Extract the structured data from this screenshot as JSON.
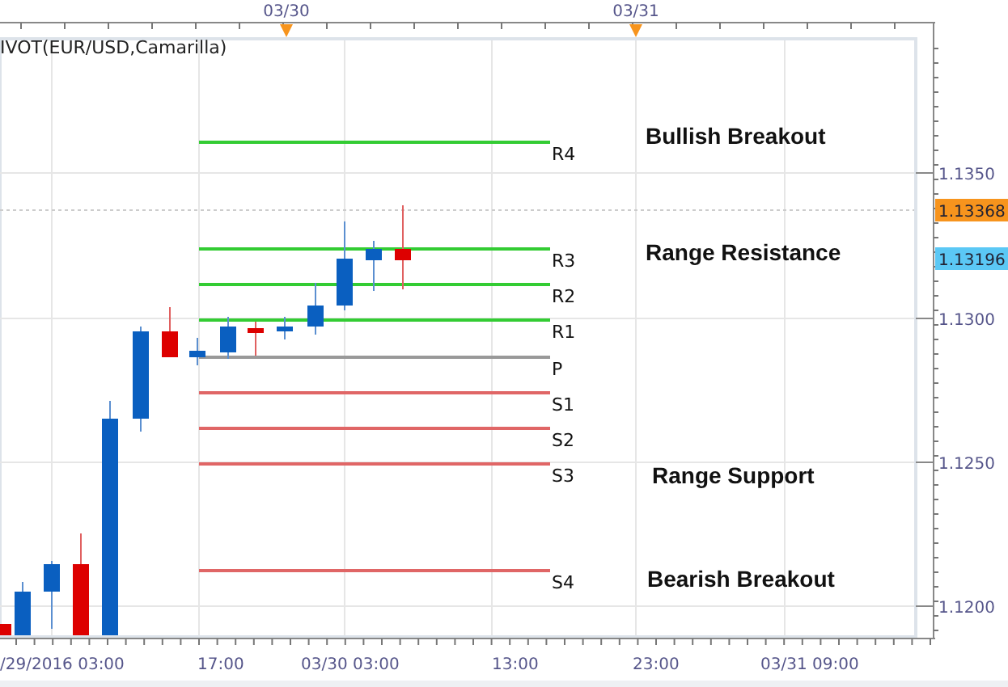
{
  "indicator_title": "IVOT(EUR/USD,Camarilla)",
  "top_axis": [
    {
      "label": "03/30"
    },
    {
      "label": "03/31"
    }
  ],
  "pivot_levels": [
    {
      "label": "R4",
      "color": "#33cc33"
    },
    {
      "label": "R3",
      "color": "#33cc33"
    },
    {
      "label": "R2",
      "color": "#33cc33"
    },
    {
      "label": "R1",
      "color": "#33cc33"
    },
    {
      "label": "P",
      "color": "#999999"
    },
    {
      "label": "S1",
      "color": "#e06666"
    },
    {
      "label": "S2",
      "color": "#e06666"
    },
    {
      "label": "S3",
      "color": "#e06666"
    },
    {
      "label": "S4",
      "color": "#e06666"
    }
  ],
  "annotations": [
    "Bullish Breakout",
    "Range Resistance",
    "Range Support",
    "Bearish Breakout"
  ],
  "price_axis": [
    "1.1350",
    "1.1300",
    "1.1250",
    "1.1200"
  ],
  "price_badges": [
    {
      "label": "1.13368",
      "color": "#f7941d"
    },
    {
      "label": "1.13196",
      "color": "#5bc8f5"
    }
  ],
  "time_axis": [
    "/29/2016 03:00",
    "17:00",
    "03/30 03:00",
    "13:00",
    "23:00",
    "03/31 09:00"
  ]
}
